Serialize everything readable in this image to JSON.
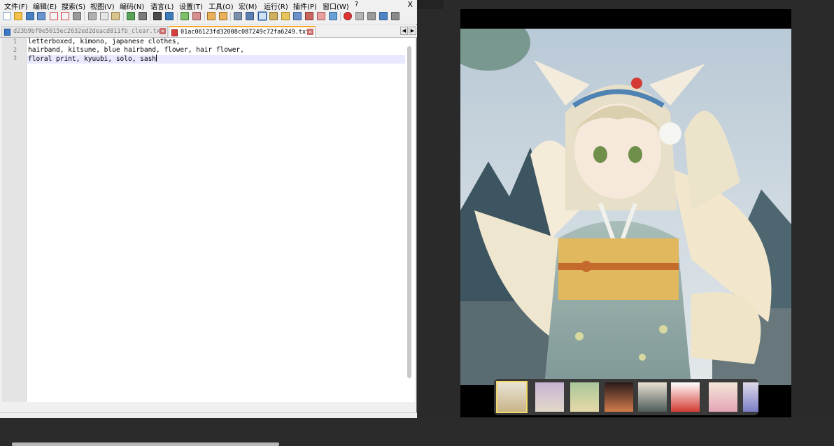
{
  "menu": {
    "items": [
      "文件(F)",
      "编辑(E)",
      "搜索(S)",
      "视图(V)",
      "编码(N)",
      "语言(L)",
      "设置(T)",
      "工具(O)",
      "宏(M)",
      "运行(R)",
      "插件(P)",
      "窗口(W)",
      "?"
    ],
    "close": "X"
  },
  "toolbar": {
    "icons": [
      "new-file-icon",
      "open-file-icon",
      "save-icon",
      "save-all-icon",
      "close-icon",
      "close-all-icon",
      "print-icon",
      "cut-icon",
      "copy-icon",
      "paste-icon",
      "undo-icon",
      "redo-icon",
      "find-icon",
      "replace-icon",
      "zoom-in-icon",
      "zoom-out-icon",
      "sync-vertical-icon",
      "sync-horizontal-icon",
      "word-wrap-icon",
      "show-all-chars-icon",
      "indent-guide-icon",
      "udl-icon",
      "doc-map-icon",
      "function-list-icon",
      "folder-workspace-icon",
      "monitoring-icon",
      "record-macro-icon",
      "stop-record-icon",
      "play-macro-icon",
      "run-macro-multiple-icon",
      "save-macro-icon"
    ]
  },
  "tabs": [
    {
      "label": "d23b9bf0e5015ec2632ed2deacd811fb_clear.txt",
      "active": false
    },
    {
      "label": "01ac06123fd32008c087249c72fa6249.txt",
      "active": true
    }
  ],
  "editor": {
    "lines": [
      {
        "num": "1",
        "text": "letterboxed, kimono, japanese clothes,"
      },
      {
        "num": "2",
        "text": "hairband, kitsune, blue hairband, flower, hair flower,"
      },
      {
        "num": "3",
        "text": "floral print, kyuubi, solo, sash"
      }
    ]
  },
  "viewer": {
    "thumbnail_count": 8,
    "current_index": 0
  },
  "colors": {
    "tab_active_accent": "#f5a623",
    "current_line": "#e8e8ff",
    "viewer_bg": "#2a2a2a",
    "thumb_selected": "#f3d86b"
  }
}
